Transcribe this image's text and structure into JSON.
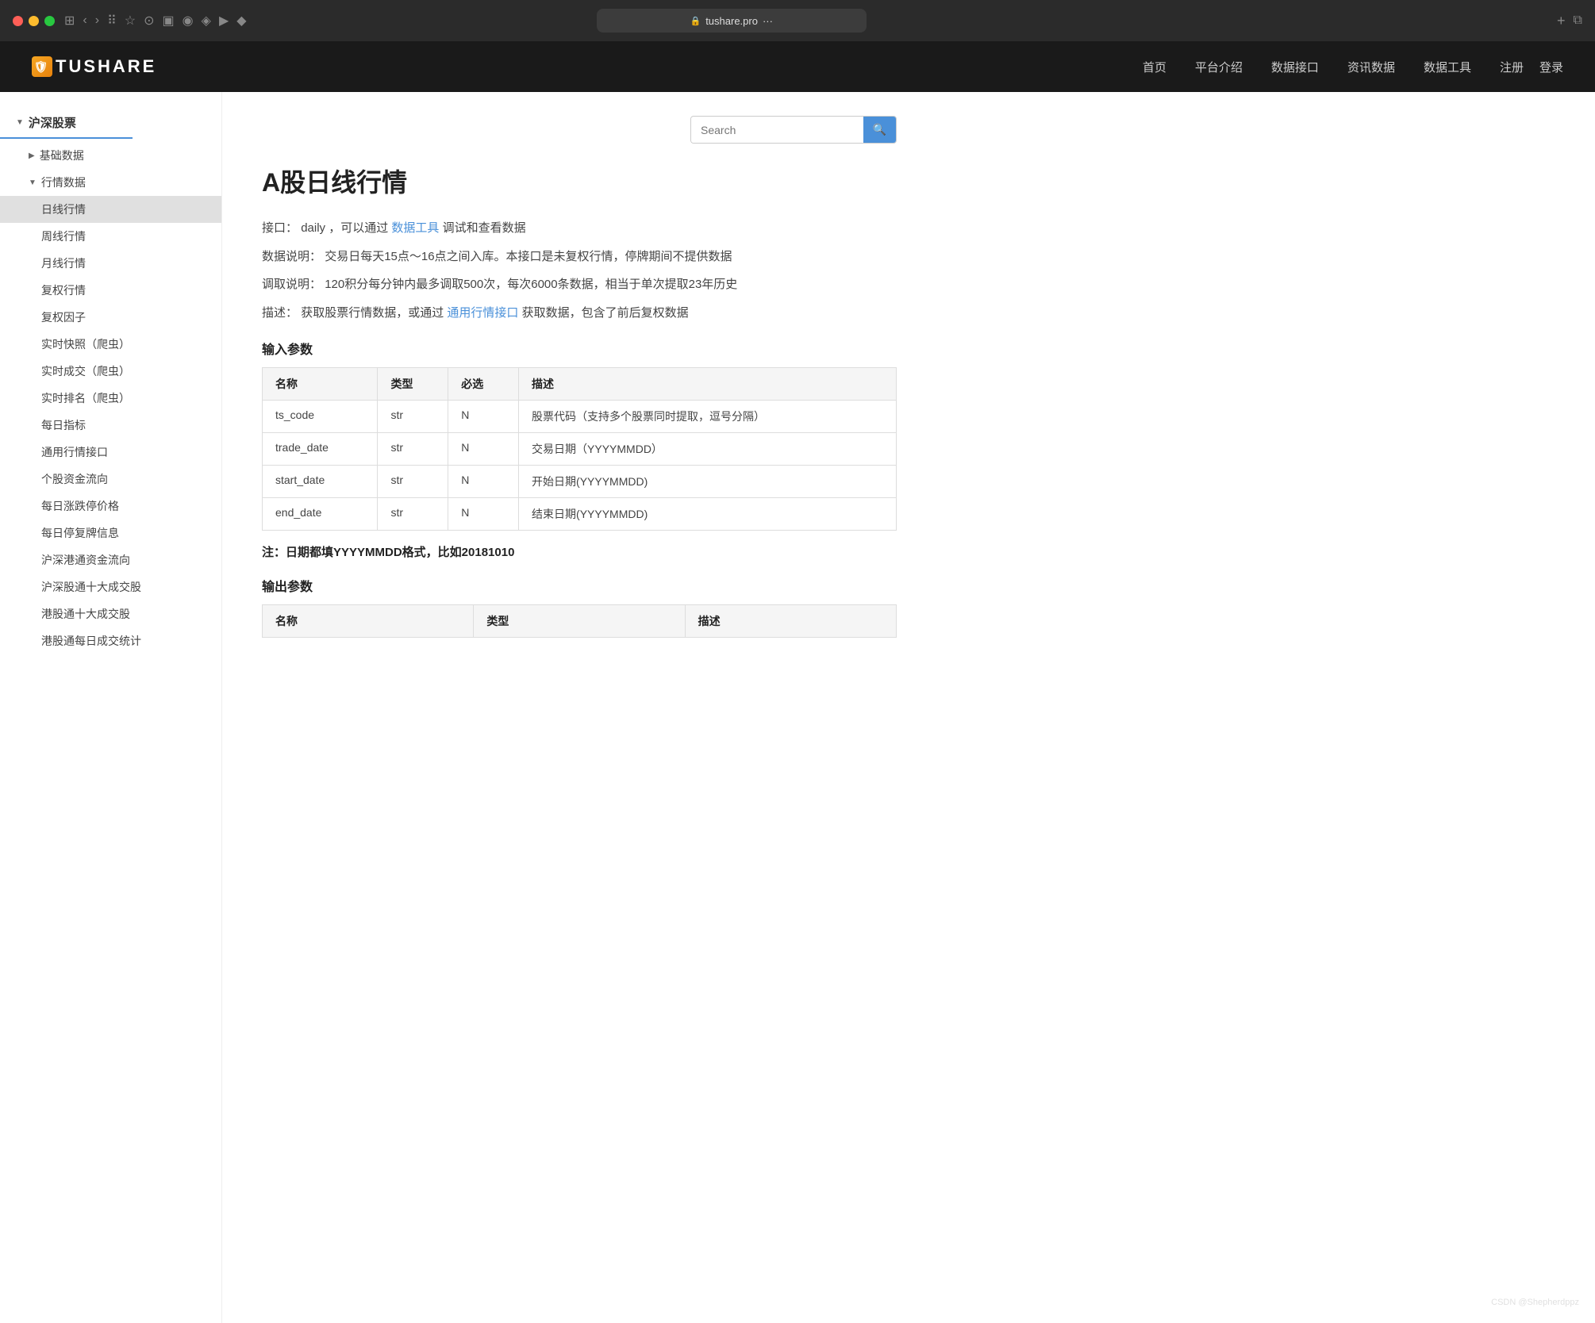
{
  "browser": {
    "url": "tushare.pro",
    "lock_icon": "🔒",
    "more_icon": "···"
  },
  "nav": {
    "logo_text": "TUSHARE",
    "logo_icon": "🛡",
    "links": [
      {
        "label": "首页",
        "id": "home"
      },
      {
        "label": "平台介绍",
        "id": "platform"
      },
      {
        "label": "数据接口",
        "id": "api"
      },
      {
        "label": "资讯数据",
        "id": "news"
      },
      {
        "label": "数据工具",
        "id": "tools"
      }
    ],
    "actions": [
      {
        "label": "注册",
        "id": "register"
      },
      {
        "label": "登录",
        "id": "login"
      }
    ]
  },
  "sidebar": {
    "section_label": "沪深股票",
    "items": [
      {
        "label": "基础数据",
        "type": "collapsed",
        "indent": 1
      },
      {
        "label": "行情数据",
        "type": "expanded",
        "indent": 1
      },
      {
        "label": "日线行情",
        "type": "leaf",
        "indent": 2,
        "active": true
      },
      {
        "label": "周线行情",
        "type": "leaf",
        "indent": 2
      },
      {
        "label": "月线行情",
        "type": "leaf",
        "indent": 2
      },
      {
        "label": "复权行情",
        "type": "leaf",
        "indent": 2
      },
      {
        "label": "复权因子",
        "type": "leaf",
        "indent": 2
      },
      {
        "label": "实时快照（爬虫）",
        "type": "leaf",
        "indent": 2
      },
      {
        "label": "实时成交（爬虫）",
        "type": "leaf",
        "indent": 2
      },
      {
        "label": "实时排名（爬虫）",
        "type": "leaf",
        "indent": 2
      },
      {
        "label": "每日指标",
        "type": "leaf",
        "indent": 2
      },
      {
        "label": "通用行情接口",
        "type": "leaf",
        "indent": 2
      },
      {
        "label": "个股资金流向",
        "type": "leaf",
        "indent": 2
      },
      {
        "label": "每日涨跌停价格",
        "type": "leaf",
        "indent": 2
      },
      {
        "label": "每日停复牌信息",
        "type": "leaf",
        "indent": 2
      },
      {
        "label": "沪深港通资金流向",
        "type": "leaf",
        "indent": 2
      },
      {
        "label": "沪深股通十大成交股",
        "type": "leaf",
        "indent": 2
      },
      {
        "label": "港股通十大成交股",
        "type": "leaf",
        "indent": 2
      },
      {
        "label": "港股通每日成交统计",
        "type": "leaf",
        "indent": 2
      }
    ]
  },
  "search": {
    "placeholder": "Search",
    "button_icon": "🔍"
  },
  "page": {
    "title": "A股日线行情",
    "interface_label": "接口：",
    "interface_name": "daily",
    "interface_suffix": "，可以通过",
    "interface_link_text": "数据工具",
    "interface_link_suffix": "调试和查看数据",
    "data_desc_label": "数据说明：",
    "data_desc_text": "交易日每天15点～16点之间入库。本接口是未复权行情，停牌期间不提供数据",
    "fetch_label": "调取说明：",
    "fetch_text": "120积分每分钟内最多调取500次，每次6000条数据，相当于单次提取23年历史",
    "desc_label": "描述：",
    "desc_text": "获取股票行情数据，或通过",
    "desc_link_text": "通用行情接口",
    "desc_link_suffix": "获取数据，包含了前后复权数据",
    "input_params_title": "输入参数",
    "note_text": "注：日期都填YYYYMMDD格式，比如20181010",
    "output_params_title": "输出参数",
    "input_table": {
      "headers": [
        "名称",
        "类型",
        "必选",
        "描述"
      ],
      "rows": [
        {
          "name": "ts_code",
          "type": "str",
          "required": "N",
          "desc": "股票代码（支持多个股票同时提取，逗号分隔）"
        },
        {
          "name": "trade_date",
          "type": "str",
          "required": "N",
          "desc": "交易日期（YYYYMMDD）"
        },
        {
          "name": "start_date",
          "type": "str",
          "required": "N",
          "desc": "开始日期(YYYYMMDD)"
        },
        {
          "name": "end_date",
          "type": "str",
          "required": "N",
          "desc": "结束日期(YYYYMMDD)"
        }
      ]
    },
    "output_table": {
      "headers": [
        "名称",
        "类型",
        "描述"
      ],
      "rows": []
    }
  },
  "watermark": "CSDN @Shepherdppz"
}
